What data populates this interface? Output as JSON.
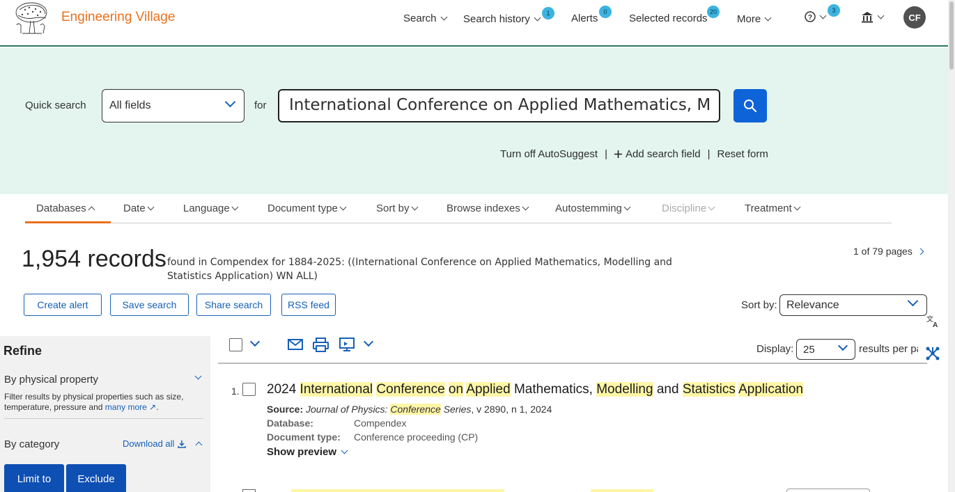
{
  "header": {
    "brand": "Engineering Village",
    "nav": {
      "search": "Search",
      "search_history": "Search history",
      "search_history_badge": "1",
      "alerts": "Alerts",
      "alerts_badge": "0",
      "selected_records": "Selected records",
      "selected_records_badge": "20",
      "more": "More",
      "help_badge": "3"
    },
    "avatar_initials": "CF"
  },
  "quick_search": {
    "label": "Quick search",
    "field": "All fields",
    "for_label": "for",
    "query": "International Conference on Applied Mathematics, M",
    "links": {
      "autosuggest": "Turn off AutoSuggest",
      "add_field": "Add search field",
      "reset": "Reset form"
    }
  },
  "filter_tabs": [
    {
      "label": "Databases",
      "state": "expanded"
    },
    {
      "label": "Date"
    },
    {
      "label": "Language"
    },
    {
      "label": "Document type"
    },
    {
      "label": "Sort by"
    },
    {
      "label": "Browse indexes"
    },
    {
      "label": "Autostemming"
    },
    {
      "label": "Discipline",
      "state": "disabled"
    },
    {
      "label": "Treatment"
    }
  ],
  "results_summary": {
    "count": "1,954 records",
    "description": "found in Compendex for 1884-2025: ((International Conference on Applied Mathematics, Modelling and Statistics Application) WN ALL)",
    "pages": "1 of 79 pages"
  },
  "actions": {
    "create_alert": "Create alert",
    "save_search": "Save search",
    "share_search": "Share search",
    "rss_feed": "RSS feed"
  },
  "sort": {
    "label": "Sort by:",
    "value": "Relevance"
  },
  "display": {
    "label": "Display:",
    "value": "25",
    "suffix": "results per page"
  },
  "refine": {
    "title": "Refine",
    "physical_property": "By physical property",
    "physical_desc": "Filter results by physical properties such as size, temperature, pressure and",
    "many_more": "many more",
    "by_category": "By category",
    "download_all": "Download all",
    "limit_to": "Limit to",
    "exclude": "Exclude"
  },
  "results": [
    {
      "number": "1.",
      "title_parts": [
        {
          "text": "2024 ",
          "hl": false
        },
        {
          "text": "International",
          "hl": true
        },
        {
          "text": " ",
          "hl": false
        },
        {
          "text": "Conference",
          "hl": true
        },
        {
          "text": " ",
          "hl": false
        },
        {
          "text": "on",
          "hl": true
        },
        {
          "text": " ",
          "hl": false
        },
        {
          "text": "Applied",
          "hl": true
        },
        {
          "text": " Mathematics, ",
          "hl": false
        },
        {
          "text": "Modelling",
          "hl": true
        },
        {
          "text": " and ",
          "hl": false
        },
        {
          "text": "Statistics",
          "hl": true
        },
        {
          "text": " ",
          "hl": false
        },
        {
          "text": "Application",
          "hl": true
        }
      ],
      "source_label": "Source:",
      "source_journal_a": "Journal of Physics: ",
      "source_journal_hl": "Conference",
      "source_journal_b": " Series",
      "source_rest": ", v 2890, n 1, 2024",
      "database_label": "Database:",
      "database": "Compendex",
      "doctype_label": "Document type:",
      "doctype": "Conference proceeding (CP)",
      "show_preview": "Show preview"
    }
  ],
  "colors": {
    "brand": "#e9711c",
    "primary": "#0e63d9",
    "search_band": "#e3f5ee",
    "badge": "#3cb3e0",
    "highlight": "#fff6a8"
  }
}
